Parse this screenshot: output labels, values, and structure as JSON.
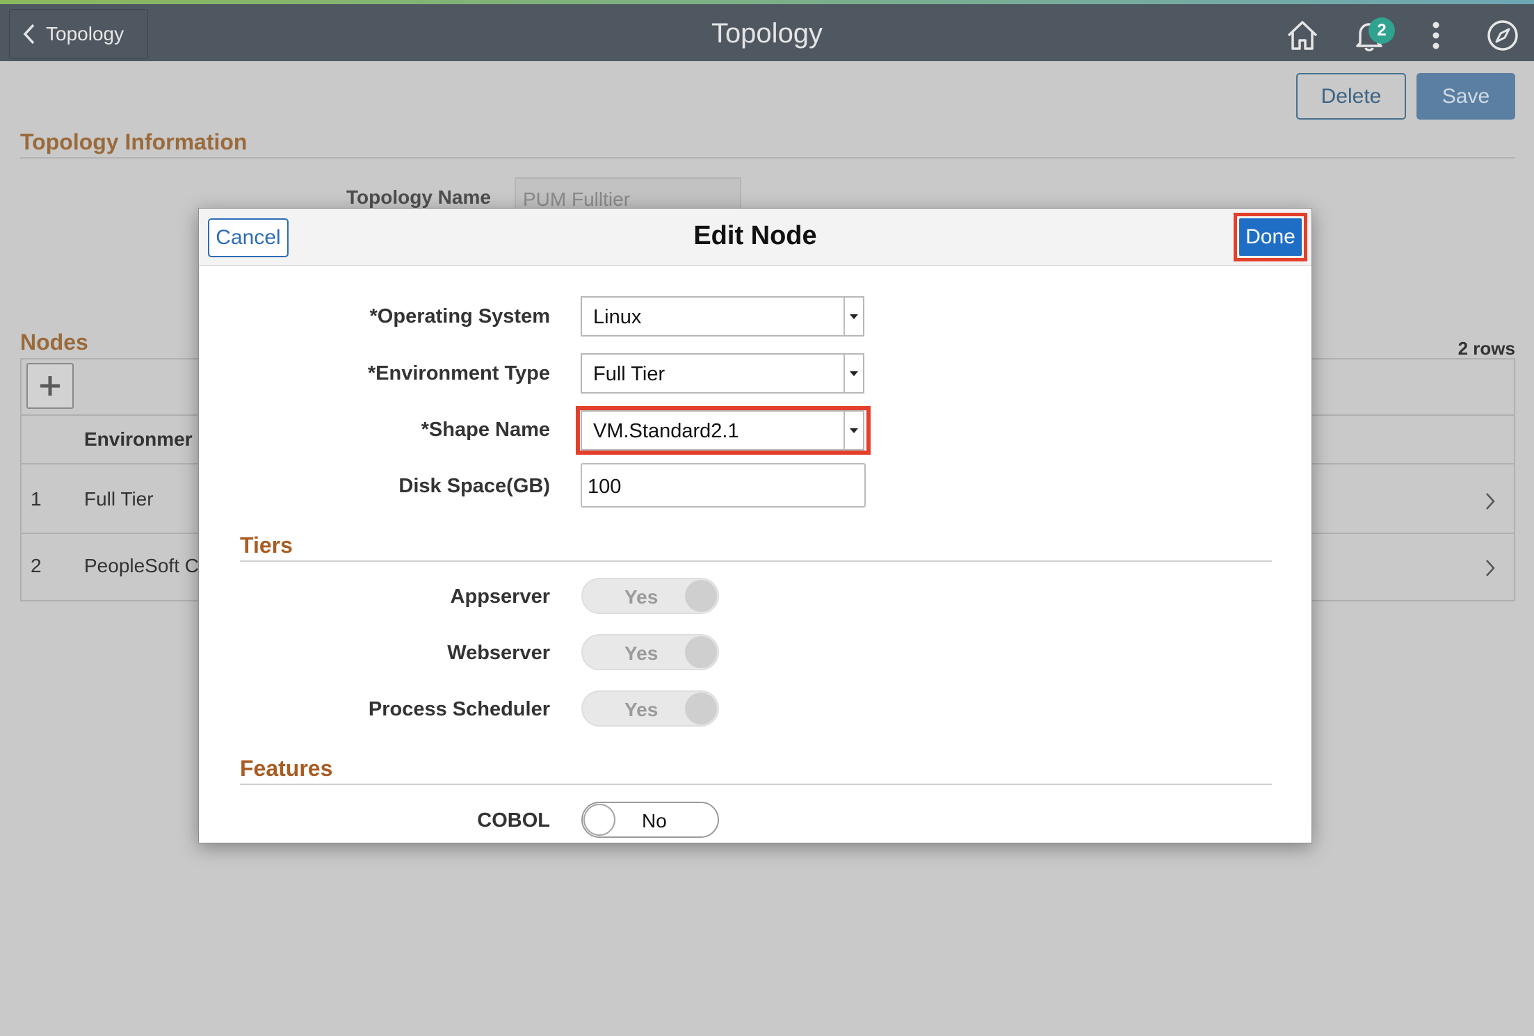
{
  "header": {
    "back_label": "Topology",
    "title": "Topology",
    "notification_count": "2",
    "icons": [
      "home-icon",
      "bell-icon",
      "more-vertical-icon",
      "compass-icon"
    ]
  },
  "page": {
    "delete_label": "Delete",
    "save_label": "Save",
    "topology_info_heading": "Topology Information",
    "topology_name_label": "Topology Name",
    "topology_name_value": "PUM Fulltier",
    "nodes_heading": "Nodes",
    "rows_count": "2 rows",
    "grid": {
      "column_header": "Environmer",
      "rows": [
        {
          "num": "1",
          "value": "Full Tier"
        },
        {
          "num": "2",
          "value": "PeopleSoft C"
        }
      ]
    }
  },
  "modal": {
    "title": "Edit Node",
    "cancel_label": "Cancel",
    "done_label": "Done",
    "fields": {
      "os_label": "*Operating System",
      "os_value": "Linux",
      "env_label": "*Environment Type",
      "env_value": "Full Tier",
      "shape_label": "*Shape Name",
      "shape_value": "VM.Standard2.1",
      "disk_label": "Disk Space(GB)",
      "disk_value": "100"
    },
    "tiers_heading": "Tiers",
    "tiers": [
      {
        "label": "Appserver",
        "state": "Yes"
      },
      {
        "label": "Webserver",
        "state": "Yes"
      },
      {
        "label": "Process Scheduler",
        "state": "Yes"
      }
    ],
    "features_heading": "Features",
    "features": [
      {
        "label": "COBOL",
        "state": "No"
      }
    ]
  },
  "colors": {
    "header_bg": "#4f5760",
    "highlight": "#e3402b",
    "primary_blue": "#1e6ec6",
    "section_heading": "#a85d24"
  }
}
